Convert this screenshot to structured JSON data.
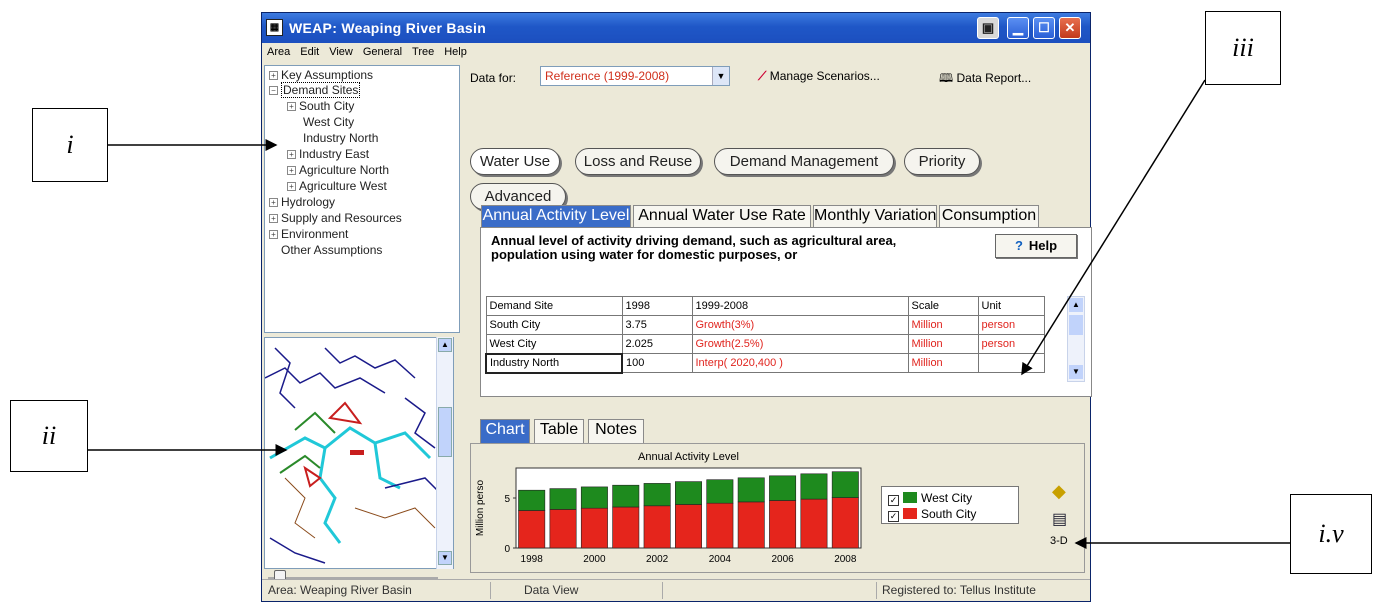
{
  "callouts": [
    "i",
    "ii",
    "iii",
    "i.v"
  ],
  "window": {
    "title": "WEAP: Weaping River Basin"
  },
  "menu": [
    "Area",
    "Edit",
    "View",
    "General",
    "Tree",
    "Help"
  ],
  "tree": [
    {
      "label": "Key Assumptions",
      "expander": "+"
    },
    {
      "label": "Demand Sites",
      "expander": "−"
    },
    {
      "label": "South City",
      "expander": "+"
    },
    {
      "label": "West City",
      "expander": ""
    },
    {
      "label": "Industry North",
      "expander": ""
    },
    {
      "label": "Industry East",
      "expander": "+"
    },
    {
      "label": "Agriculture North",
      "expander": "+"
    },
    {
      "label": "Agriculture West",
      "expander": "+"
    },
    {
      "label": "Hydrology",
      "expander": "+"
    },
    {
      "label": "Supply and Resources",
      "expander": "+"
    },
    {
      "label": "Environment",
      "expander": "+"
    },
    {
      "label": "Other Assumptions",
      "expander": ""
    }
  ],
  "toolbar": {
    "data_for_label": "Data for:",
    "scenario": "Reference (1999-2008)",
    "manage_label": "Manage Scenarios...",
    "report_label": "Data Report..."
  },
  "category_buttons": [
    "Water Use",
    "Loss and Reuse",
    "Demand Management",
    "Priority",
    "Advanced"
  ],
  "tabs": [
    "Annual Activity Level",
    "Annual Water Use Rate",
    "Monthly Variation",
    "Consumption"
  ],
  "description": "Annual level of activity driving demand, such as agricultural area, population using water for domestic purposes, or",
  "help_label": "Help",
  "table": {
    "headers": [
      "Demand Site",
      "1998",
      "1999-2008",
      "Scale",
      "Unit"
    ],
    "rows": [
      [
        "South City",
        "3.75",
        "Growth(3%)",
        "Million",
        "person"
      ],
      [
        "West City",
        "2.025",
        "Growth(2.5%)",
        "Million",
        "person"
      ],
      [
        "Industry North",
        "100",
        "Interp( 2020,400 )",
        "Million",
        ""
      ]
    ]
  },
  "bottom_tabs": [
    "Chart",
    "Table",
    "Notes"
  ],
  "chart_data": {
    "type": "bar",
    "title": "Annual Activity Level",
    "ylabel": "Million perso",
    "xlabel": "",
    "categories": [
      "1998",
      "1999",
      "2000",
      "2001",
      "2002",
      "2003",
      "2004",
      "2005",
      "2006",
      "2007",
      "2008"
    ],
    "xtick_labels": [
      "1998",
      "2000",
      "2002",
      "2004",
      "2006",
      "2008"
    ],
    "yticks": [
      "0",
      "5"
    ],
    "ylim": [
      0,
      8
    ],
    "stacked": true,
    "series": [
      {
        "name": "South City",
        "color": "#e5251c",
        "values": [
          3.75,
          3.86,
          3.98,
          4.1,
          4.22,
          4.35,
          4.48,
          4.61,
          4.75,
          4.89,
          5.04
        ]
      },
      {
        "name": "West City",
        "color": "#1e8a1e",
        "values": [
          2.03,
          2.08,
          2.13,
          2.18,
          2.24,
          2.29,
          2.35,
          2.41,
          2.47,
          2.53,
          2.59
        ]
      }
    ],
    "legend_position": "right"
  },
  "side_label": "3-D",
  "status": {
    "area": "Area: Weaping River Basin",
    "view": "Data View",
    "registered": "Registered to: Tellus Institute"
  }
}
